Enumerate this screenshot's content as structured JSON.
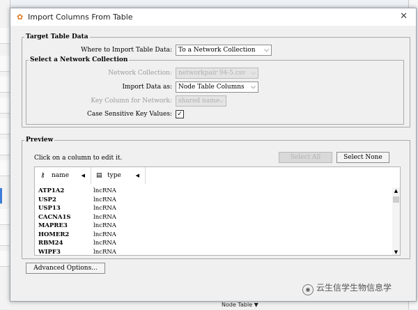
{
  "window": {
    "title": "Import Columns From Table",
    "app_icon": "cytoscape-logo-icon",
    "close_glyph": "✕"
  },
  "target_group": {
    "legend": "Target Table Data",
    "where_label": "Where to Import Table Data:",
    "where_value": "To a Network Collection"
  },
  "network_group": {
    "legend": "Select a Network Collection",
    "collection_label": "Network Collection:",
    "collection_value": "networkpair 94-5.csv",
    "import_as_label": "Import Data as:",
    "import_as_value": "Node Table Columns",
    "key_column_label": "Key Column for Network:",
    "key_column_value": "shared name",
    "case_label": "Case Sensitive Key Values:",
    "case_checked": true
  },
  "preview": {
    "legend": "Preview",
    "hint": "Click on a column to edit it.",
    "select_all_label": "Select All",
    "select_none_label": "Select None",
    "columns": [
      {
        "icon": "key-icon",
        "name": "name",
        "sort_glyph": "◀"
      },
      {
        "icon": "document-icon",
        "name": "type",
        "sort_glyph": "◀"
      }
    ],
    "rows": [
      {
        "name": "ATP1A2",
        "type": "lncRNA"
      },
      {
        "name": "USP2",
        "type": "lncRNA"
      },
      {
        "name": "USP13",
        "type": "lncRNA"
      },
      {
        "name": "CACNA1S",
        "type": "lncRNA"
      },
      {
        "name": "MAPRE3",
        "type": "lncRNA"
      },
      {
        "name": "HOMER2",
        "type": "lncRNA"
      },
      {
        "name": "RBM24",
        "type": "lncRNA"
      },
      {
        "name": "WIPF3",
        "type": "lncRNA"
      }
    ]
  },
  "advanced_label": "Advanced Options...",
  "background": {
    "node_table_label": "Node Table ▼"
  },
  "watermark": {
    "text": "云生信学生物信息学"
  },
  "colors": {
    "accent": "#3b7dd8",
    "app_icon": "#e07a1f",
    "disabled_text": "#9b9b9b"
  }
}
